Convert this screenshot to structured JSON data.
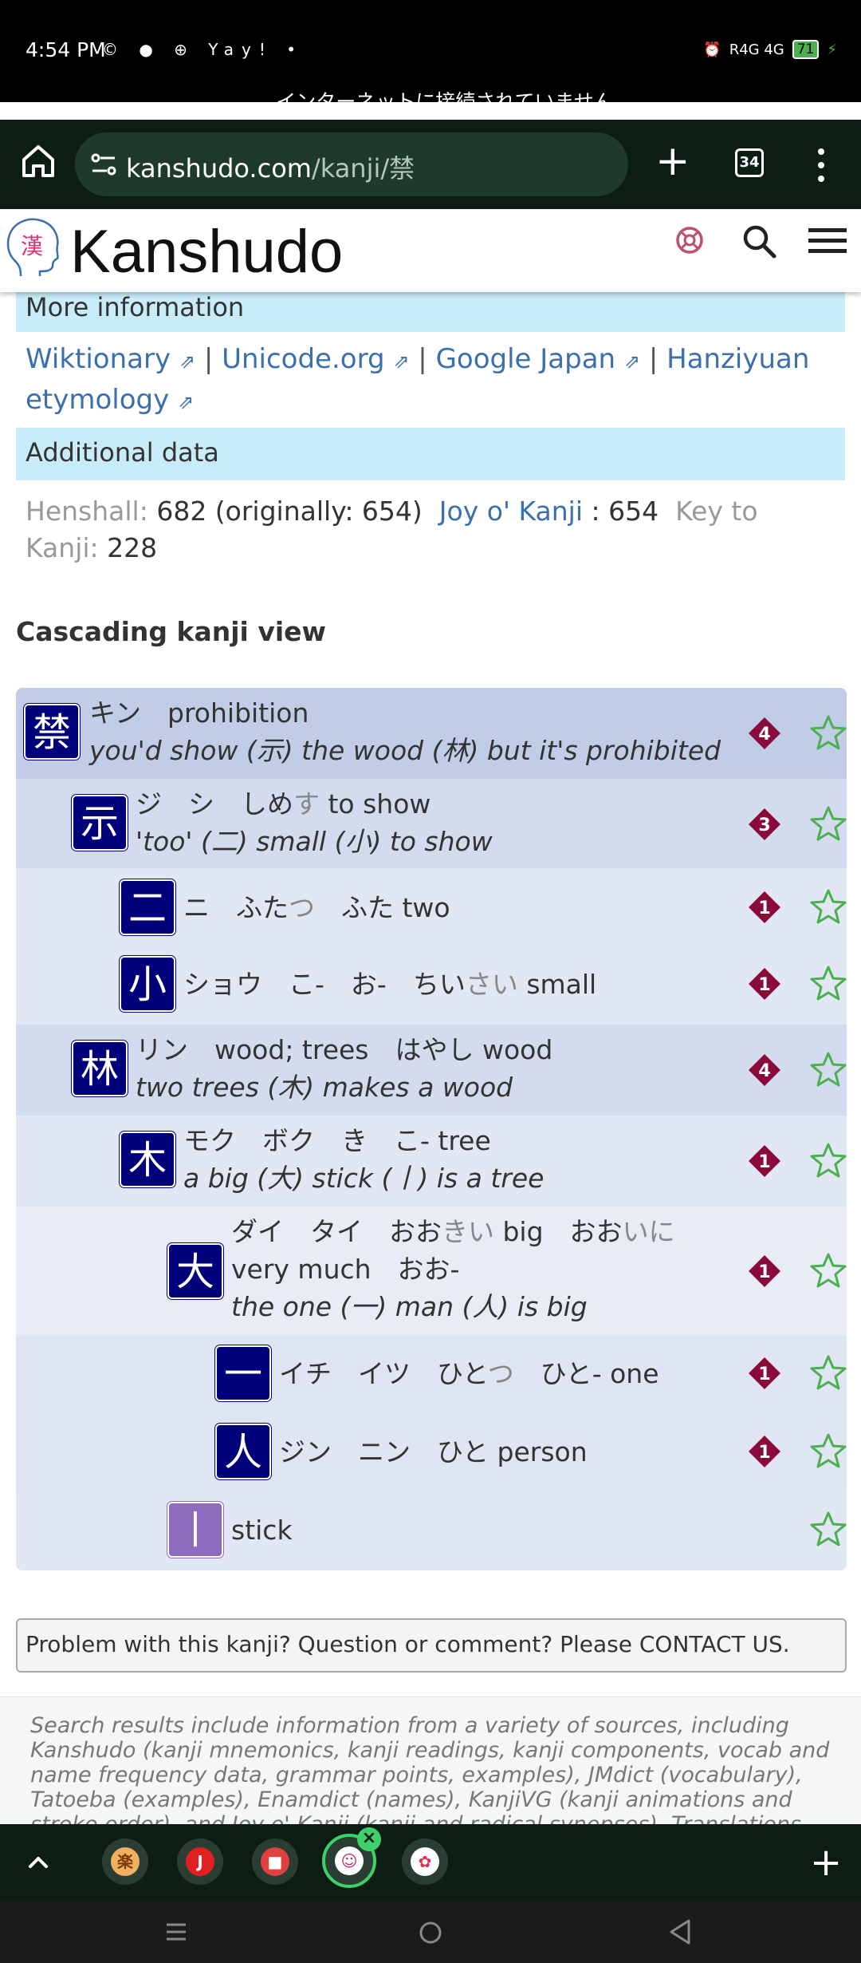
{
  "status_bar": {
    "time": "4:54 PM",
    "notification_icons": "© ● ⊕ Yay! •",
    "network": "R4G 4G",
    "battery": "71",
    "offline_message": "インターネットに接続されていません"
  },
  "browser": {
    "url_host": "kanshudo.com",
    "url_path": "/kanji/禁",
    "tab_count": "34"
  },
  "site": {
    "logo_glyph": "漢",
    "brand": "Kanshudo"
  },
  "more_info": {
    "heading": "More information",
    "links": [
      {
        "label": "Wiktionary",
        "ext": "⇗"
      },
      {
        "label": "Unicode.org",
        "ext": "⇗"
      },
      {
        "label": "Google Japan",
        "ext": "⇗"
      },
      {
        "label": "Hanziyuan etymology",
        "ext": "⇗"
      }
    ],
    "separator": "|"
  },
  "additional": {
    "heading": "Additional data",
    "henshall_label": "Henshall:",
    "henshall_value": "682 (originally: 654)",
    "joy_label": "Joy o' Kanji",
    "joy_value": ": 654",
    "key_label": "Key to Kanji:",
    "key_value": "228"
  },
  "cascade": {
    "title": "Cascading kanji view",
    "rows": [
      {
        "kanji": "禁",
        "line1": "キン　prohibition",
        "line2": "you'd show (示) the wood (林) but it's prohibited",
        "badge": "4"
      },
      {
        "kanji": "示",
        "line1a": "ジ　シ　しめ",
        "line1b": "す",
        "line1c": " to show",
        "line2": "'too' (二) small (小) to show",
        "badge": "3"
      },
      {
        "kanji": "二",
        "line1a": "ニ　ふた",
        "line1b": "つ",
        "line1c": "　ふた two",
        "badge": "1"
      },
      {
        "kanji": "小",
        "line1a": "ショウ　こ-　お-　ちい",
        "line1b": "さい",
        "line1c": " small",
        "badge": "1"
      },
      {
        "kanji": "林",
        "line1": "リン　wood; trees　はやし wood",
        "line2": "two trees (木) makes a wood",
        "badge": "4"
      },
      {
        "kanji": "木",
        "line1": "モク　ボク　き　こ- tree",
        "line2": "a big (大) stick (丨) is a tree",
        "badge": "1"
      },
      {
        "kanji": "大",
        "line1a": "ダイ　タイ　おお",
        "line1b": "きい",
        "line1c": " big　おお",
        "line1d": "いに",
        "line2a": "very much　おお-",
        "line3": "the one (一) man (人) is big",
        "badge": "1"
      },
      {
        "kanji": "一",
        "line1a": "イチ　イツ　ひと",
        "line1b": "つ",
        "line1c": "　ひと- one",
        "badge": "1"
      },
      {
        "kanji": "人",
        "line1": "ジン　ニン　ひと person",
        "badge": "1"
      },
      {
        "kanji": "丨",
        "line1": "stick"
      }
    ]
  },
  "problem_text": "Problem with this kanji? Question or comment? Please CONTACT US.",
  "disclaimer": "Search results include information from a variety of sources, including Kanshudo (kanji mnemonics, kanji readings, kanji components, vocab and name frequency data, grammar points, examples), JMdict (vocabulary), Tatoeba (examples), Enamdict (names), KanjiVG (kanji animations and stroke order), and Joy o' Kanji (kanji and radical synopses). Translations provided by",
  "bottom_apps": [
    {
      "glyph": "楽",
      "color": "#f0b060"
    },
    {
      "glyph": "J",
      "color": "#e02020"
    },
    {
      "glyph": "■",
      "color": "#e04040"
    },
    {
      "glyph": "☺",
      "color": "#ffffff"
    },
    {
      "glyph": "✿",
      "color": "#e03050"
    }
  ],
  "colors": {
    "accent_link": "#3b6fae",
    "info_bar": "#c8ecfa",
    "kanji_box": "#00007a",
    "badge": "#8b0a3c",
    "star": "#4caf50"
  }
}
